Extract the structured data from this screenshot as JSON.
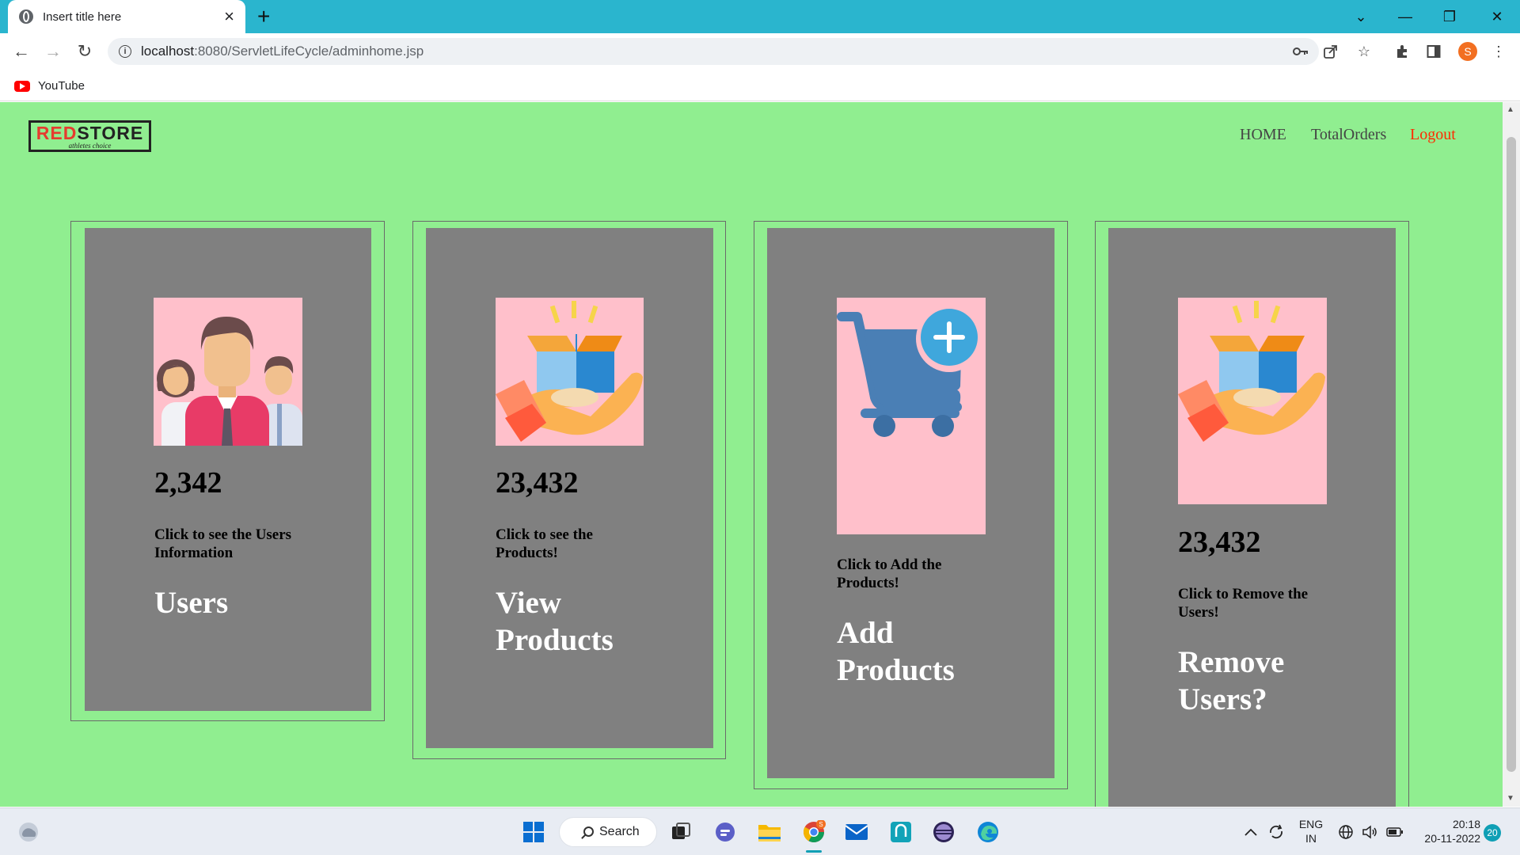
{
  "browser": {
    "tab_title": "Insert title here",
    "url_host": "localhost",
    "url_rest": ":8080/ServletLifeCycle/adminhome.jsp",
    "profile_initial": "S",
    "bookmarks": [
      {
        "label": "YouTube"
      }
    ]
  },
  "page": {
    "logo": {
      "red": "RED",
      "black": "STORE",
      "tagline": "athletes choice"
    },
    "nav": {
      "home": "HOME",
      "orders": "TotalOrders",
      "logout": "Logout"
    },
    "cards": [
      {
        "icon": "users-icon",
        "number": "2,342",
        "description": "Click to see the Users Information",
        "title": "Users"
      },
      {
        "icon": "product-in-hand-icon",
        "number": "23,432",
        "description": "Click to see the Products!",
        "title": "View Products"
      },
      {
        "icon": "cart-add-icon",
        "description": "Click to Add the Products!",
        "title": "Add Products"
      },
      {
        "icon": "product-in-hand-icon",
        "number": "23,432",
        "description": "Click to Remove the Users!",
        "title": "Remove Users?"
      }
    ],
    "colors": {
      "background": "#90ee90",
      "card": "#808080",
      "image_bg": "#ffc0cb",
      "logout": "#ff2a00"
    }
  },
  "taskbar": {
    "search_label": "Search",
    "language": "ENG",
    "region": "IN",
    "time": "20:18",
    "date": "20-11-2022",
    "notifications": "20",
    "chrome_badge": "S"
  }
}
